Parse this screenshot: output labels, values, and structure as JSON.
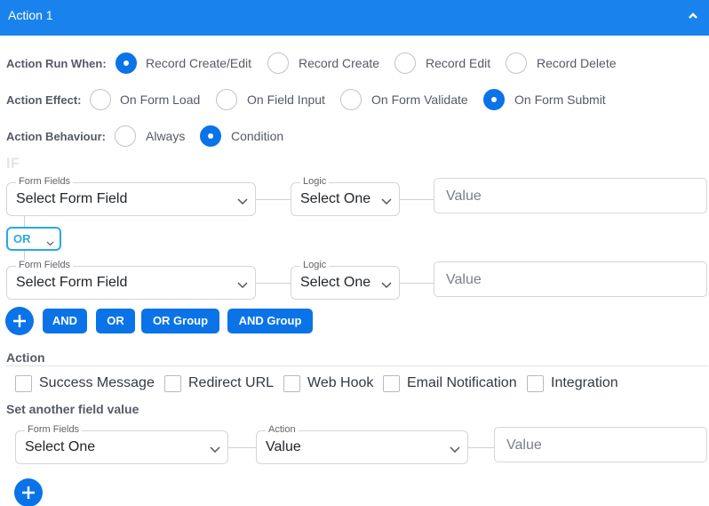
{
  "header": {
    "title": "Action 1",
    "collapse_icon": "chevron-up-icon"
  },
  "run_when": {
    "label": "Action Run When:",
    "options": [
      {
        "label": "Record Create/Edit",
        "selected": true
      },
      {
        "label": "Record Create",
        "selected": false
      },
      {
        "label": "Record Edit",
        "selected": false
      },
      {
        "label": "Record Delete",
        "selected": false
      }
    ]
  },
  "effect": {
    "label": "Action Effect:",
    "options": [
      {
        "label": "On Form Load",
        "selected": false
      },
      {
        "label": "On Field Input",
        "selected": false
      },
      {
        "label": "On Form Validate",
        "selected": false
      },
      {
        "label": "On Form Submit",
        "selected": true
      }
    ]
  },
  "behaviour": {
    "label": "Action Behaviour:",
    "options": [
      {
        "label": "Always",
        "selected": false
      },
      {
        "label": "Condition",
        "selected": true
      }
    ]
  },
  "condition": {
    "if_label": "IF",
    "rows": [
      {
        "field_legend": "Form Fields",
        "field_value": "Select Form Field",
        "logic_legend": "Logic",
        "logic_value": "Select One",
        "value_placeholder": "Value"
      },
      {
        "field_legend": "Form Fields",
        "field_value": "Select Form Field",
        "logic_legend": "Logic",
        "logic_value": "Select One",
        "value_placeholder": "Value"
      }
    ],
    "joiner": "OR",
    "buttons": {
      "and": "AND",
      "or": "OR",
      "or_group": "OR Group",
      "and_group": "AND Group"
    }
  },
  "action": {
    "title": "Action",
    "checkboxes": [
      {
        "label": "Success Message",
        "checked": false
      },
      {
        "label": "Redirect URL",
        "checked": false
      },
      {
        "label": "Web Hook",
        "checked": false
      },
      {
        "label": "Email Notification",
        "checked": false
      },
      {
        "label": "Integration",
        "checked": false
      }
    ]
  },
  "set_field": {
    "title": "Set another field value",
    "field_legend": "Form Fields",
    "field_value": "Select One",
    "action_legend": "Action",
    "action_value": "Value",
    "value_placeholder": "Value"
  },
  "colors": {
    "header": "#1a82ec",
    "accent": "#0b73e8",
    "or_select": "#29a9e1"
  }
}
